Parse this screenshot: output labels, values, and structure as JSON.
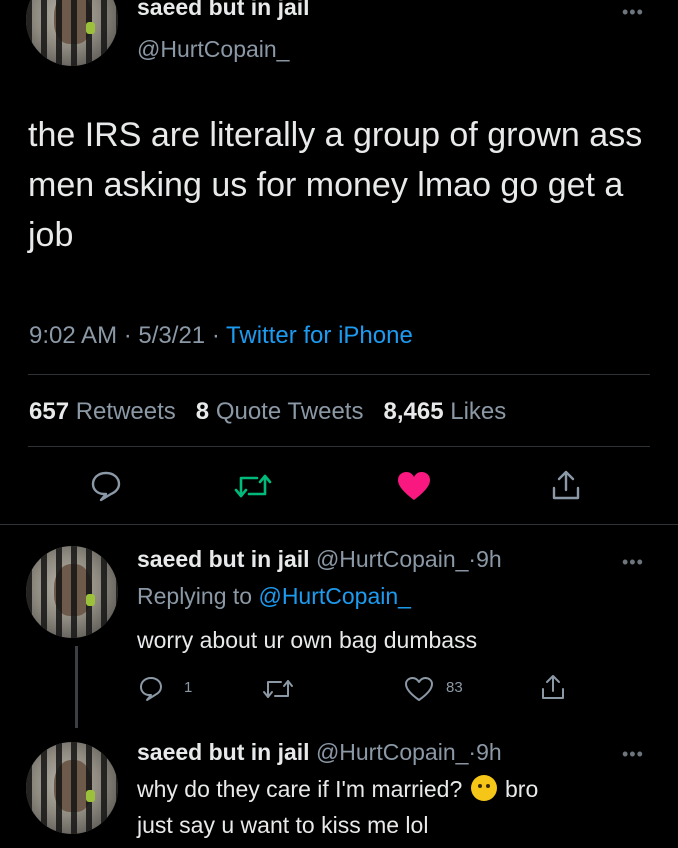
{
  "main_tweet": {
    "author_name": "saeed but in jail",
    "handle": "@HurtCopain_",
    "text": "the IRS are literally a group of grown ass men asking us for money lmao go get a job",
    "time": "9:02 AM",
    "date": "5/3/21",
    "source": "Twitter for iPhone",
    "retweets_count": "657",
    "retweets_label": "Retweets",
    "quote_count": "8",
    "quote_label": "Quote Tweets",
    "likes_count": "8,465",
    "likes_label": "Likes",
    "liked": true
  },
  "replies": [
    {
      "author_name": "saeed but in jail",
      "handle": "@HurtCopain_",
      "age": "9h",
      "replying_to_label": "Replying to",
      "replying_to_handle": "@HurtCopain_",
      "text": "worry about ur own bag dumbass",
      "reply_count": "1",
      "like_count": "83"
    },
    {
      "author_name": "saeed but in jail",
      "handle": "@HurtCopain_",
      "age": "9h",
      "text_before_emoji": "why do they care if I'm married?",
      "text_after_emoji": "bro",
      "text_line2": "just say u want to kiss me lol"
    }
  ],
  "separator": "·",
  "icons": {
    "more": "more-dots-icon",
    "reply": "reply-bubble-icon",
    "retweet": "retweet-icon",
    "like": "heart-icon",
    "share": "share-icon",
    "emoji": "raised-eyebrow-emoji-icon"
  },
  "colors": {
    "background": "#000000",
    "primary_text": "#e7e9ea",
    "secondary_text": "#8b98a5",
    "link": "#1d9bf0",
    "retweet_green": "#00ba7c",
    "like_pink": "#f91880"
  }
}
